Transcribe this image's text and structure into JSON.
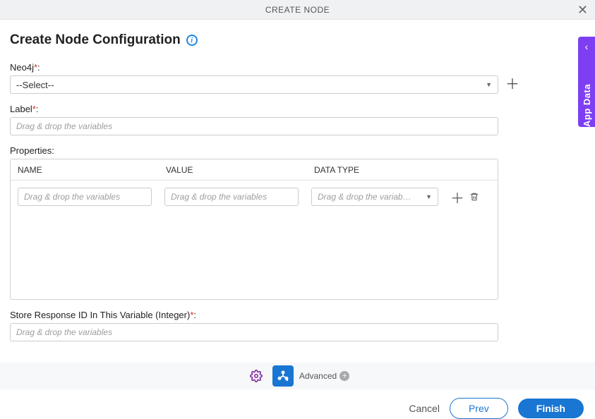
{
  "titlebar": {
    "title": "CREATE NODE"
  },
  "heading": {
    "text": "Create Node Configuration"
  },
  "fields": {
    "neo4j": {
      "label": "Neo4j",
      "required": "*",
      "colon": ":",
      "selected": "--Select--"
    },
    "label": {
      "label": "Label",
      "required": "*",
      "colon": ":",
      "placeholder": "Drag & drop the variables"
    },
    "properties": {
      "label": "Properties:",
      "columns": {
        "name": "NAME",
        "value": "VALUE",
        "type": "DATA TYPE"
      },
      "rows": [
        {
          "name_placeholder": "Drag & drop the variables",
          "value_placeholder": "Drag & drop the variables",
          "type_placeholder": "Drag & drop the variab…"
        }
      ]
    },
    "store": {
      "label": "Store Response ID In This Variable (Integer)",
      "required": "*",
      "colon": ":",
      "placeholder": "Drag & drop the variables"
    }
  },
  "toolbar": {
    "advanced_label": "Advanced"
  },
  "footer": {
    "cancel": "Cancel",
    "prev": "Prev",
    "finish": "Finish"
  },
  "sidetab": {
    "label": "App Data"
  }
}
